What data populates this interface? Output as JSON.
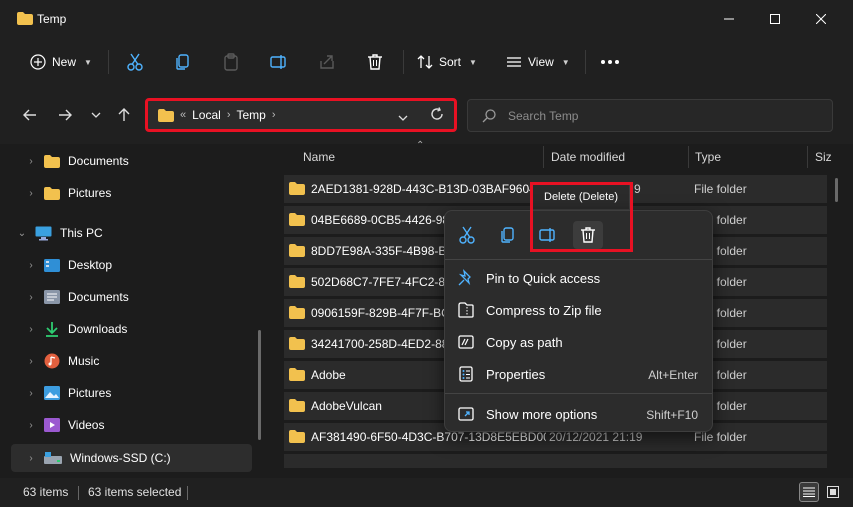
{
  "window": {
    "title": "Temp"
  },
  "toolbar": {
    "new_label": "New",
    "sort_label": "Sort",
    "view_label": "View"
  },
  "address": {
    "crumb1": "Local",
    "crumb2": "Temp",
    "overflow": "«"
  },
  "search": {
    "placeholder": "Search Temp"
  },
  "sidebar": {
    "items": [
      {
        "label": "Documents",
        "icon": "folder-icon"
      },
      {
        "label": "Pictures",
        "icon": "folder-icon"
      },
      {
        "label": "This PC",
        "icon": "monitor-icon"
      },
      {
        "label": "Desktop",
        "icon": "desktop-icon"
      },
      {
        "label": "Documents",
        "icon": "documents-icon"
      },
      {
        "label": "Downloads",
        "icon": "download-icon"
      },
      {
        "label": "Music",
        "icon": "music-icon"
      },
      {
        "label": "Pictures",
        "icon": "pictures-icon"
      },
      {
        "label": "Videos",
        "icon": "videos-icon"
      },
      {
        "label": "Windows-SSD (C:)",
        "icon": "drive-icon"
      }
    ]
  },
  "columns": {
    "name": "Name",
    "date": "Date modified",
    "type": "Type",
    "size": "Siz"
  },
  "files": [
    {
      "name": "2AED1381-928D-443C-B13D-03BAF9604F...",
      "date": "",
      "date_tail": "9",
      "type": "File folder"
    },
    {
      "name": "04BE6689-0CB5-4426-984",
      "date": "",
      "type": "File folder"
    },
    {
      "name": "8DD7E98A-335F-4B98-B7",
      "date": "",
      "type": "File folder"
    },
    {
      "name": "502D68C7-7FE7-4FC2-88C",
      "date": "",
      "type": "File folder"
    },
    {
      "name": "0906159F-829B-4F7F-BC0",
      "date": "",
      "type": "File folder"
    },
    {
      "name": "34241700-258D-4ED2-887",
      "date": "",
      "type": "File folder"
    },
    {
      "name": "Adobe",
      "date": "",
      "type": "File folder"
    },
    {
      "name": "AdobeVulcan",
      "date": "",
      "type": "File folder"
    },
    {
      "name": "AF381490-6F50-4D3C-B707-13D8E5EBD005",
      "date": "20/12/2021 21:19",
      "type": "File folder"
    }
  ],
  "context_menu": {
    "tooltip": "Delete (Delete)",
    "items": [
      {
        "label": "Pin to Quick access",
        "shortcut": "",
        "icon": "pin-icon"
      },
      {
        "label": "Compress to Zip file",
        "shortcut": "",
        "icon": "zip-icon"
      },
      {
        "label": "Copy as path",
        "shortcut": "",
        "icon": "copy-path-icon"
      },
      {
        "label": "Properties",
        "shortcut": "Alt+Enter",
        "icon": "properties-icon"
      },
      {
        "label": "Show more options",
        "shortcut": "Shift+F10",
        "icon": "more-options-icon"
      }
    ]
  },
  "status": {
    "count": "63 items",
    "selected": "63 items selected"
  },
  "colors": {
    "accent": "#e81123",
    "folder": "#f2c14e"
  }
}
